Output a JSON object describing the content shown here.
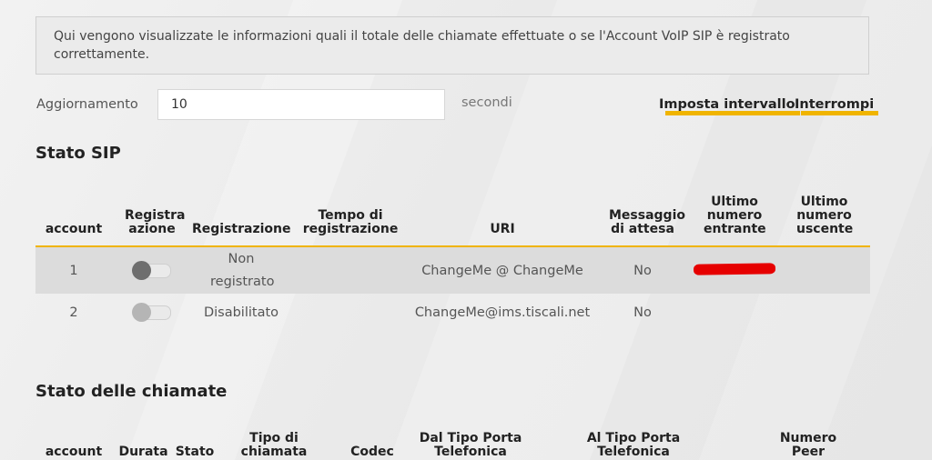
{
  "info": "Qui vengono visualizzate le informazioni quali il totale delle chiamate effettuate o se l'Account VoIP SIP è registrato correttamente.",
  "refresh": {
    "label": "Aggiornamento",
    "value": "10",
    "unit": "secondi",
    "set_interval_label": "Imposta intervallo",
    "stop_label": "Interrompi"
  },
  "sip_status": {
    "title": "Stato SIP",
    "columns": {
      "account": "account",
      "register": "Registra azione",
      "registration": "Registrazione",
      "reg_time": "Tempo di registrazione",
      "uri": "URI",
      "message_waiting": "Messaggio di attesa",
      "last_incoming": "Ultimo numero entrante",
      "last_outgoing": "Ultimo numero uscente"
    },
    "rows": [
      {
        "account": "1",
        "toggle": "off",
        "registration": "Non registrato",
        "reg_time": "",
        "uri": "ChangeMe @ ChangeMe",
        "message_waiting": "No",
        "last_incoming": "[redacted]",
        "last_outgoing": ""
      },
      {
        "account": "2",
        "toggle": "disabled",
        "registration": "Disabilitato",
        "reg_time": "",
        "uri": "ChangeMe@ims.tiscali.net",
        "message_waiting": "No",
        "last_incoming": "",
        "last_outgoing": ""
      }
    ]
  },
  "call_status": {
    "title": "Stato delle chiamate",
    "columns": {
      "account": "account",
      "duration": "Durata",
      "state": "Stato",
      "call_type": "Tipo di chiamata",
      "codec": "Codec",
      "from_port_type": "Dal Tipo Porta Telefonica",
      "to_port_type": "Al Tipo Porta Telefonica",
      "peer_number": "Numero Peer"
    }
  },
  "colors": {
    "accent": "#f0b400",
    "redaction": "#e60000",
    "toggle_knob_off": "#6e6e6e",
    "toggle_knob_disabled": "#b5b5b5"
  }
}
